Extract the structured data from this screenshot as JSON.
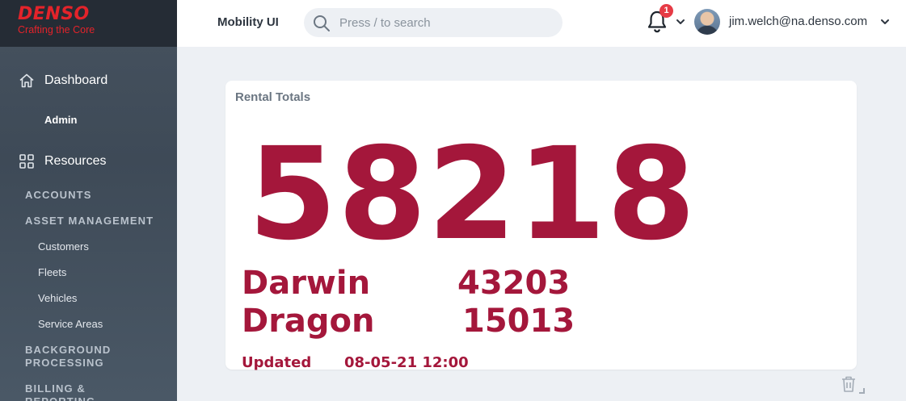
{
  "brand": {
    "name": "DENSO",
    "tagline": "Crafting the Core"
  },
  "sidebar": {
    "dashboard": {
      "label": "Dashboard",
      "icon": "home-icon"
    },
    "admin": "Admin",
    "resources": {
      "label": "Resources",
      "icon": "grid-icon"
    },
    "sections": [
      {
        "label": "ACCOUNTS"
      },
      {
        "label": "ASSET MANAGEMENT"
      },
      {
        "label": "BACKGROUND PROCESSING"
      },
      {
        "label": "BILLING & REPORTING"
      }
    ],
    "items": [
      "Customers",
      "Fleets",
      "Vehicles",
      "Service Areas"
    ]
  },
  "header": {
    "app_title": "Mobility UI",
    "search_placeholder": "Press / to search",
    "notification_count": "1",
    "user_email": "jim.welch@na.denso.com"
  },
  "card": {
    "title": "Rental Totals",
    "total": "58218",
    "rows": [
      {
        "name": "Darwin",
        "value": "43203"
      },
      {
        "name": "Dragon",
        "value": "15013"
      }
    ],
    "updated_label": "Updated",
    "updated_value": "08-05-21 12:00"
  },
  "colors": {
    "accent": "#a4173b",
    "brand_red": "#e3232a",
    "badge": "#e63b45",
    "sidebar": "#46525f"
  }
}
